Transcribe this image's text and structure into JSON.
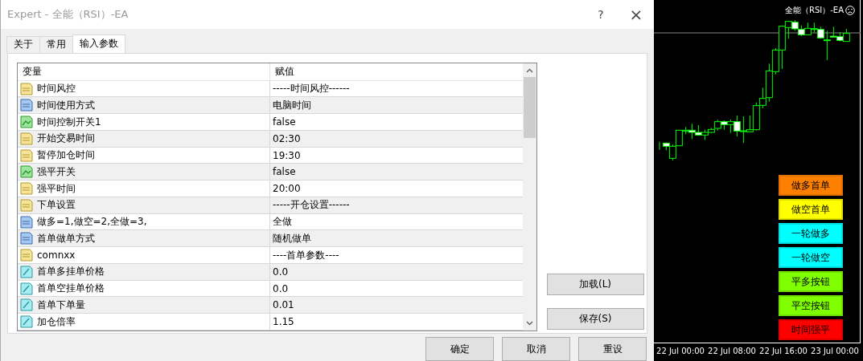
{
  "window": {
    "title": "Expert - 全能（RSI）-EA",
    "help": "?",
    "close": "×"
  },
  "tabs": [
    {
      "label": "关于",
      "selected": false
    },
    {
      "label": "常用",
      "selected": false
    },
    {
      "label": "输入参数",
      "selected": true
    }
  ],
  "table": {
    "columns": [
      "变量",
      "赋值"
    ],
    "rows": [
      {
        "kind": "string",
        "name": "时间风控",
        "value": "-----时间风控------"
      },
      {
        "kind": "int",
        "name": "时间使用方式",
        "value": "电脑时间"
      },
      {
        "kind": "bool",
        "name": "时间控制开关1",
        "value": "false"
      },
      {
        "kind": "string",
        "name": "开始交易时间",
        "value": "02:30"
      },
      {
        "kind": "string",
        "name": "暂停加仓时间",
        "value": "19:30"
      },
      {
        "kind": "bool",
        "name": "强平开关",
        "value": "false"
      },
      {
        "kind": "string",
        "name": "强平时间",
        "value": "20:00"
      },
      {
        "kind": "string",
        "name": "下单设置",
        "value": "-----开仓设置------"
      },
      {
        "kind": "int",
        "name": "做多=1,做空=2,全做=3,",
        "value": "全做"
      },
      {
        "kind": "int",
        "name": "首单做单方式",
        "value": "随机做单"
      },
      {
        "kind": "string",
        "name": "comnxx",
        "value": "----首单参数----"
      },
      {
        "kind": "double",
        "name": "首单多挂单价格",
        "value": "0.0"
      },
      {
        "kind": "double",
        "name": "首单空挂单价格",
        "value": "0.0"
      },
      {
        "kind": "double",
        "name": "首单下单量",
        "value": "0.01"
      },
      {
        "kind": "double",
        "name": "加仓倍率",
        "value": "1.15"
      }
    ]
  },
  "side_buttons": [
    "加载(L)",
    "保存(S)"
  ],
  "buttons": [
    "确定",
    "取消",
    "重设"
  ],
  "chart": {
    "title": "全能（RSI）-EA",
    "buttons": [
      {
        "label": "做多首单",
        "color": "#ff8000"
      },
      {
        "label": "做空首单",
        "color": "#ffff00"
      },
      {
        "label": "一轮做多",
        "color": "#00ffff"
      },
      {
        "label": "一轮做空",
        "color": "#00ffff"
      },
      {
        "label": "平多按钮",
        "color": "#80ff00"
      },
      {
        "label": "平空按钮",
        "color": "#80ff00"
      },
      {
        "label": "时间强平",
        "color": "#ff0000"
      }
    ],
    "time_labels": [
      "22 Jul 00:00",
      "22 Jul 08:00",
      "22 Jul 16:00",
      "23 Jul 00:00"
    ]
  }
}
